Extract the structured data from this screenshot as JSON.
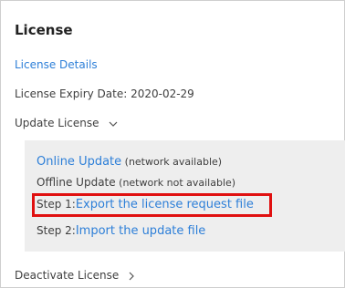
{
  "license": {
    "title": "License",
    "details_link": "License Details",
    "expiry": "License Expiry Date: 2020-02-29",
    "update_label": "Update License",
    "update_icon": "chevron-down-icon",
    "options": {
      "online_link": "Online Update",
      "online_note": " (network available)",
      "offline_label": "Offline Update",
      "offline_note": " (network not available)",
      "step1_prefix": "Step 1:",
      "step1_link": "Export the license request file",
      "step2_prefix": "Step 2:",
      "step2_link": "Import the update file"
    },
    "deactivate_label": "Deactivate License",
    "deactivate_icon": "chevron-right-icon"
  },
  "colors": {
    "link": "#2d7fd8",
    "highlight": "#e01010",
    "panel_bg": "#eeeeee"
  }
}
